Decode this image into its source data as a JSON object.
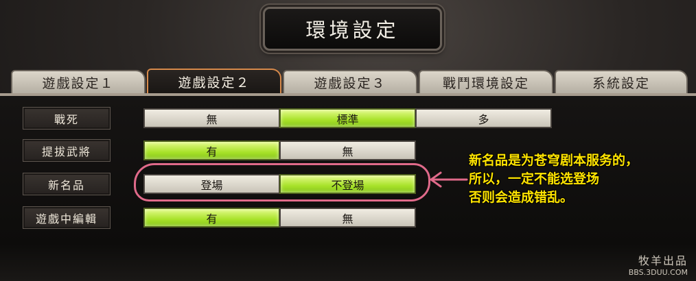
{
  "title": "環境設定",
  "tabs": [
    {
      "label": "遊戲設定１",
      "active": false
    },
    {
      "label": "遊戲設定２",
      "active": true
    },
    {
      "label": "遊戲設定３",
      "active": false
    },
    {
      "label": "戰鬥環境設定",
      "active": false
    },
    {
      "label": "系統設定",
      "active": false
    }
  ],
  "rows": [
    {
      "label": "戰死",
      "options": [
        "無",
        "標準",
        "多"
      ],
      "selected": "標準"
    },
    {
      "label": "提拔武將",
      "options": [
        "有",
        "無"
      ],
      "selected": "有"
    },
    {
      "label": "新名品",
      "options": [
        "登場",
        "不登場"
      ],
      "selected": "不登場"
    },
    {
      "label": "遊戲中編輯",
      "options": [
        "有",
        "無"
      ],
      "selected": "有"
    }
  ],
  "annotation": {
    "lines": [
      "新名品是为苍穹剧本服务的，",
      "所以，一定不能选登场",
      "否则会造成错乱。"
    ],
    "color": "#ffe400",
    "circle_color": "#e06a8a"
  },
  "watermark": {
    "line1": "牧羊出品",
    "line2": "BBS.3DUU.COM"
  },
  "colors": {
    "selected": "#a8e22a",
    "active_tab_border": "#d88a4a"
  }
}
